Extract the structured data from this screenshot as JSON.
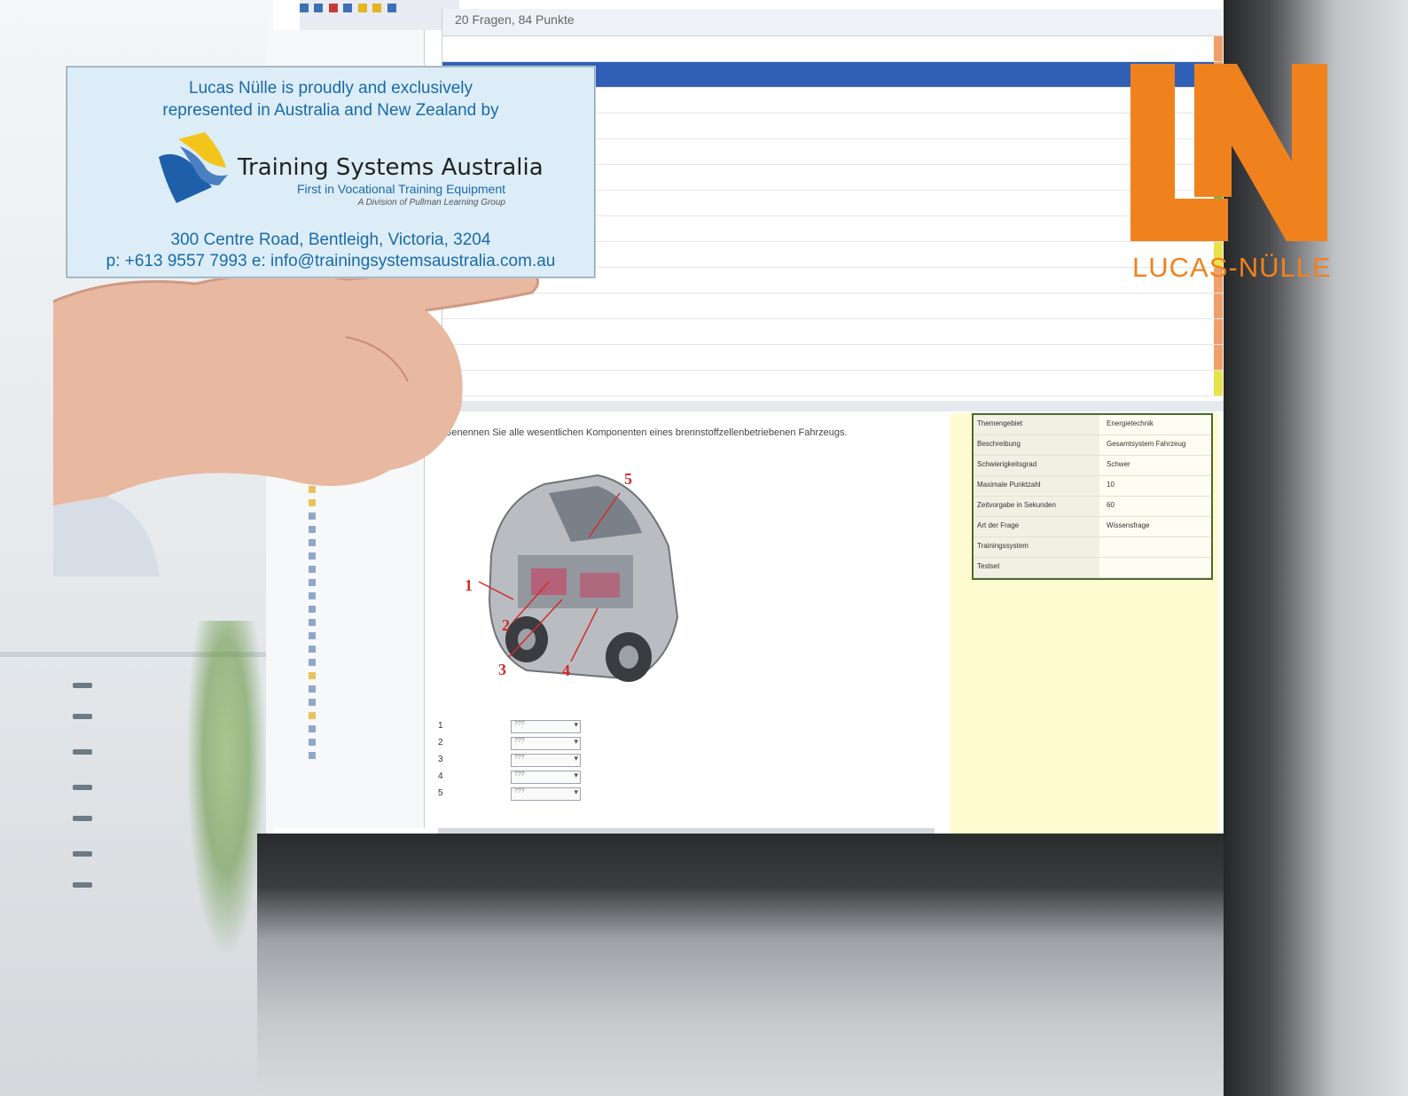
{
  "card": {
    "intro_line1": "Lucas Nülle is proudly and exclusively",
    "intro_line2": "represented in Australia and New Zealand by",
    "company_name": "Training Systems Australia",
    "tagline": "First in Vocational Training Equipment",
    "division": "A Division of Pullman Learning Group",
    "address": "300 Centre Road, Bentleigh, Victoria, 3204",
    "contact": "p: +613 9557 7993    e: info@trainingsystemsaustralia.com.au"
  },
  "brand_logo": {
    "monogram": "LN",
    "wordmark": "LUCAS-NÜLLE",
    "color": "#f0821e"
  },
  "screen": {
    "list_header": "20 Fragen, 84 Punkte",
    "question_text": "Benennen Sie alle wesentlichen Komponenten eines brennstoffzellenbetriebenen Fahrzeugs.",
    "car_callouts": [
      "1",
      "2",
      "3",
      "4",
      "5"
    ],
    "answer_rows": [
      {
        "number": "1",
        "value": "???"
      },
      {
        "number": "2",
        "value": "???"
      },
      {
        "number": "3",
        "value": "???"
      },
      {
        "number": "4",
        "value": "???"
      },
      {
        "number": "5",
        "value": "???"
      }
    ],
    "properties": [
      {
        "key": "Themengebiet",
        "value": "Energietechnik"
      },
      {
        "key": "Beschreibung",
        "value": "Gesamtsystem Fahrzeug"
      },
      {
        "key": "Schwierigkeitsgrad",
        "value": "Schwer"
      },
      {
        "key": "Maximale Punktzahl",
        "value": "10"
      },
      {
        "key": "Zeitvorgabe in Sekunden",
        "value": "60"
      },
      {
        "key": "Art der Frage",
        "value": "Wissensfrage"
      },
      {
        "key": "Trainingssystem",
        "value": ""
      },
      {
        "key": "Testset",
        "value": ""
      }
    ]
  }
}
